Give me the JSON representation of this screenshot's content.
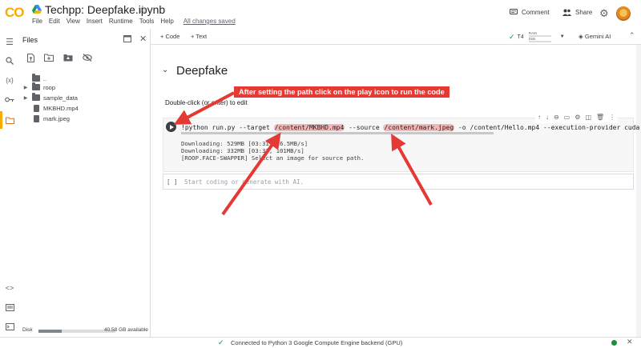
{
  "app": {
    "logo_text": "CO",
    "notebook_title": "Techpp: Deepfake.ipynb",
    "save_status": "All changes saved",
    "menu": [
      "File",
      "Edit",
      "View",
      "Insert",
      "Runtime",
      "Tools",
      "Help"
    ],
    "comment_label": "Comment",
    "share_label": "Share"
  },
  "files_panel": {
    "title": "Files",
    "tree": [
      {
        "label": "..",
        "kind": "folder",
        "expandable": false
      },
      {
        "label": "roop",
        "kind": "folder",
        "expandable": true
      },
      {
        "label": "sample_data",
        "kind": "folder",
        "expandable": true
      },
      {
        "label": "MKBHD.mp4",
        "kind": "file",
        "expandable": false
      },
      {
        "label": "mark.jpeg",
        "kind": "file",
        "expandable": false
      }
    ],
    "disk_label": "Disk",
    "disk_available": "40.58 GB available",
    "disk_used_fraction": 0.3
  },
  "toolbar": {
    "add_code": "+ Code",
    "add_text": "+ Text",
    "runtime_type": "T4",
    "ram_label": "RAM",
    "disk_label": "Disk",
    "gemini_label": "Gemini AI"
  },
  "notebook": {
    "section_title": "Deepfake",
    "text_cell_hint": "Double-click (or enter) to edit",
    "code_cell": {
      "cmd_prefix": "!python run.py --target ",
      "target_path": "/content/MKBHD.mp4",
      "source_flag": " --source ",
      "source_path": "/content/mark.jpeg",
      "cmd_suffix": " -o /content/Hello.mp4 --execution-provider cuda",
      "output": [
        "Downloading: 529MB [03:31, 26.5MB/s]",
        "Downloading: 332MB [03:33, 101MB/s]",
        "[ROOP.FACE-SWAPPER] Select an image for source path."
      ]
    },
    "empty_cell": {
      "bracket": "[ ]",
      "placeholder": "Start coding or generate with AI."
    }
  },
  "annotation": {
    "text": "After setting the path click on the play icon to run the code",
    "color": "#e53935"
  },
  "statusbar": {
    "text": "Connected to Python 3 Google Compute Engine backend (GPU)",
    "status_color": "#1e8e3e"
  }
}
